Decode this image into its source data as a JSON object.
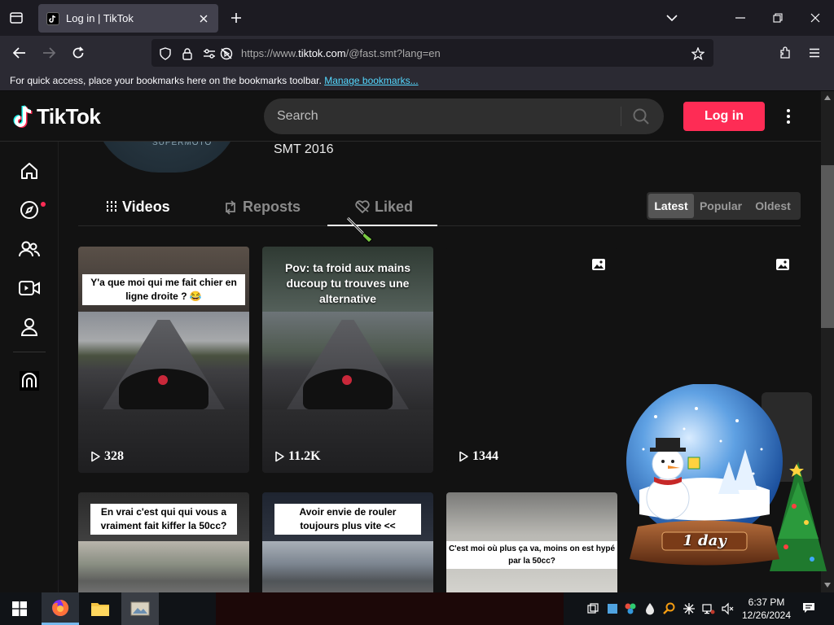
{
  "browser": {
    "tab_title": "Log in | TikTok",
    "url_prefix": "https://www.",
    "url_host": "tiktok.com",
    "url_path": "/@fast.smt?lang=en",
    "bookmarks_text": "For quick access, place your bookmarks here on the bookmarks toolbar.",
    "bookmarks_link": "Manage bookmarks..."
  },
  "header": {
    "logo_text": "TikTok",
    "search_placeholder": "Search",
    "login_label": "Log in"
  },
  "profile": {
    "bio": "SMT 2016",
    "avatar_text": "SUPERMOTO"
  },
  "tabs": {
    "videos": "Videos",
    "reposts": "Reposts",
    "liked": "Liked"
  },
  "sort": {
    "latest": "Latest",
    "popular": "Popular",
    "oldest": "Oldest"
  },
  "videos": [
    {
      "caption": "Y'a que moi qui me fait chier en ligne droite ? 😂",
      "views": "328"
    },
    {
      "caption": "Pov: ta froid aux mains ducoup tu trouves une alternative",
      "views": "11.2K"
    },
    {
      "caption": "",
      "views": "1344"
    },
    {
      "caption": "En vrai c'est qui qui vous a vraiment fait kiffer la 50cc?",
      "views": ""
    },
    {
      "caption": "Avoir envie de rouler toujours plus vite <<",
      "views": ""
    },
    {
      "caption": "C'est moi où plus ça va, moins on est hypé par la 50cc?",
      "views": ""
    }
  ],
  "widget": {
    "globe_label": "1 day"
  },
  "taskbar": {
    "time": "6:37 PM",
    "date": "12/26/2024"
  },
  "colors": {
    "accent": "#fe2c55",
    "background": "#121212"
  }
}
